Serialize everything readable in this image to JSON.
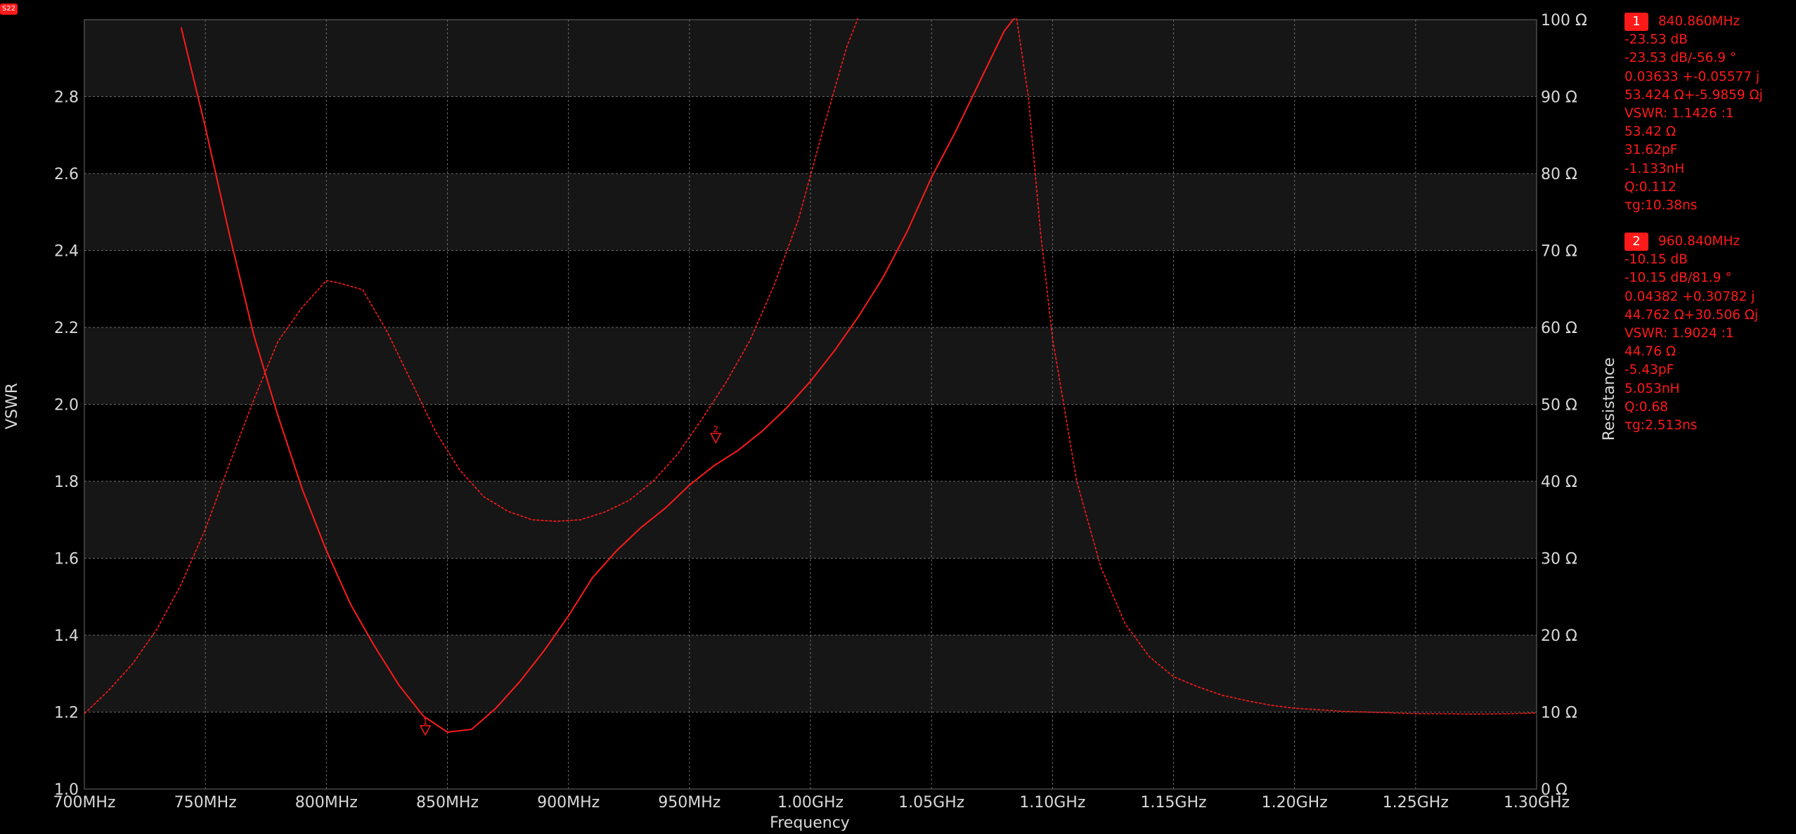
{
  "trace_badge": "S22",
  "colors": {
    "trace": "#ff1a1a",
    "grid": "#6a6a6a",
    "band": "#161616",
    "text": "#d9d9d9",
    "background": "#000000"
  },
  "chart_data": {
    "type": "line",
    "xlabel": "Frequency",
    "ylabel": "VSWR",
    "y2label": "Resistance",
    "x_range_hz": [
      700000000,
      1300000000
    ],
    "ylim": [
      1.0,
      3.0
    ],
    "y2lim": [
      0,
      100
    ],
    "grid": true,
    "x_tick_values": [
      700000000,
      750000000,
      800000000,
      850000000,
      900000000,
      950000000,
      1000000000,
      1050000000,
      1100000000,
      1150000000,
      1200000000,
      1250000000,
      1300000000
    ],
    "x_tick_labels": [
      "700MHz",
      "750MHz",
      "800MHz",
      "850MHz",
      "900MHz",
      "950MHz",
      "1.00GHz",
      "1.05GHz",
      "1.10GHz",
      "1.15GHz",
      "1.20GHz",
      "1.25GHz",
      "1.30GHz"
    ],
    "y_tick_values": [
      1.0,
      1.2,
      1.4,
      1.6,
      1.8,
      2.0,
      2.2,
      2.4,
      2.6,
      2.8
    ],
    "y_tick_labels": [
      "1.0",
      "1.2",
      "1.4",
      "1.6",
      "1.8",
      "2.0",
      "2.2",
      "2.4",
      "2.6",
      "2.8"
    ],
    "y2_tick_values": [
      0,
      10,
      20,
      30,
      40,
      50,
      60,
      70,
      80,
      90,
      100
    ],
    "y2_tick_labels": [
      "0 Ω",
      "10 Ω",
      "20 Ω",
      "30 Ω",
      "40 Ω",
      "50 Ω",
      "60 Ω",
      "70 Ω",
      "80 Ω",
      "90 Ω",
      "100 Ω"
    ],
    "series": [
      {
        "axis": "left",
        "style": "solid",
        "x_mhz": [
          740,
          750,
          760,
          770,
          780,
          790,
          800,
          810,
          820,
          830,
          840,
          850,
          860,
          870,
          880,
          890,
          900,
          910,
          920,
          930,
          940,
          950,
          960,
          970,
          980,
          990,
          1000,
          1010,
          1020,
          1030,
          1040,
          1050,
          1060,
          1070,
          1080,
          1085
        ],
        "y": [
          2.98,
          2.72,
          2.44,
          2.18,
          1.97,
          1.78,
          1.62,
          1.48,
          1.37,
          1.27,
          1.19,
          1.148,
          1.155,
          1.21,
          1.28,
          1.36,
          1.45,
          1.55,
          1.62,
          1.68,
          1.73,
          1.79,
          1.84,
          1.88,
          1.93,
          1.99,
          2.06,
          2.14,
          2.23,
          2.33,
          2.45,
          2.59,
          2.71,
          2.84,
          2.97,
          3.01
        ]
      },
      {
        "axis": "right",
        "style": "dashed",
        "x_mhz": [
          700,
          710,
          720,
          730,
          740,
          750,
          760,
          770,
          780,
          790,
          800,
          805,
          815,
          825,
          835,
          845,
          855,
          865,
          875,
          885,
          895,
          905,
          915,
          925,
          935,
          945,
          955,
          965,
          975,
          985,
          995,
          1005,
          1015,
          1020,
          1025,
          1030,
          1040,
          1050,
          1060,
          1070,
          1080,
          1085,
          1090,
          1095,
          1100,
          1110,
          1120,
          1130,
          1140,
          1150,
          1160,
          1170,
          1180,
          1190,
          1200,
          1210,
          1220,
          1230,
          1240,
          1250,
          1260,
          1270,
          1280,
          1290,
          1300
        ],
        "y": [
          9.8,
          12.8,
          16.3,
          20.8,
          26.6,
          33.8,
          42.3,
          50.6,
          58.2,
          62.6,
          66.1,
          65.8,
          64.9,
          59.5,
          53.0,
          46.5,
          41.5,
          38.0,
          36.1,
          35.0,
          34.8,
          35.0,
          36.0,
          37.5,
          40.0,
          43.5,
          48.0,
          52.8,
          58.3,
          65.5,
          74.0,
          85.5,
          96.5,
          100.5,
          100.5,
          100.5,
          100.5,
          100.5,
          100.5,
          100.5,
          100.5,
          100.5,
          90.0,
          72.5,
          58.6,
          40.0,
          28.8,
          21.5,
          17.2,
          14.6,
          13.3,
          12.2,
          11.5,
          10.9,
          10.5,
          10.3,
          10.1,
          10.0,
          9.9,
          9.8,
          9.8,
          9.75,
          9.75,
          9.8,
          9.9
        ]
      }
    ],
    "markers": [
      {
        "id": "1",
        "freq_mhz": 840.86,
        "trace_value": 1.1426,
        "readout": [
          "840.860MHz",
          "-23.53 dB",
          "-23.53 dB/-56.9 °",
          "0.03633 +-0.05577 j",
          "53.424 Ω+-5.9859 Ωj",
          "VSWR: 1.1426 :1",
          "53.42 Ω",
          "31.62pF",
          "-1.133nH",
          "Q:0.112",
          "τg:10.38ns"
        ]
      },
      {
        "id": "2",
        "freq_mhz": 960.84,
        "trace_value": 1.9024,
        "readout": [
          "960.840MHz",
          "-10.15 dB",
          "-10.15 dB/81.9 °",
          "0.04382 +0.30782 j",
          "44.762 Ω+30.506 Ωj",
          "VSWR: 1.9024 :1",
          "44.76 Ω",
          "-5.43pF",
          "5.053nH",
          "Q:0.68",
          "τg:2.513ns"
        ]
      }
    ]
  }
}
